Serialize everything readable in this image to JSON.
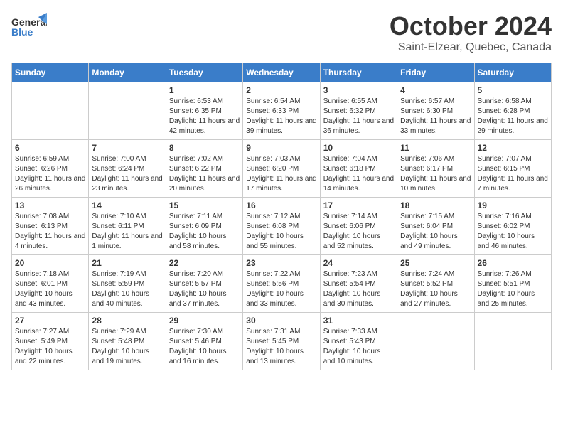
{
  "logo": {
    "general": "General",
    "blue": "Blue"
  },
  "title": "October 2024",
  "subtitle": "Saint-Elzear, Quebec, Canada",
  "weekdays": [
    "Sunday",
    "Monday",
    "Tuesday",
    "Wednesday",
    "Thursday",
    "Friday",
    "Saturday"
  ],
  "weeks": [
    [
      {
        "day": "",
        "sunrise": "",
        "sunset": "",
        "daylight": ""
      },
      {
        "day": "",
        "sunrise": "",
        "sunset": "",
        "daylight": ""
      },
      {
        "day": "1",
        "sunrise": "Sunrise: 6:53 AM",
        "sunset": "Sunset: 6:35 PM",
        "daylight": "Daylight: 11 hours and 42 minutes."
      },
      {
        "day": "2",
        "sunrise": "Sunrise: 6:54 AM",
        "sunset": "Sunset: 6:33 PM",
        "daylight": "Daylight: 11 hours and 39 minutes."
      },
      {
        "day": "3",
        "sunrise": "Sunrise: 6:55 AM",
        "sunset": "Sunset: 6:32 PM",
        "daylight": "Daylight: 11 hours and 36 minutes."
      },
      {
        "day": "4",
        "sunrise": "Sunrise: 6:57 AM",
        "sunset": "Sunset: 6:30 PM",
        "daylight": "Daylight: 11 hours and 33 minutes."
      },
      {
        "day": "5",
        "sunrise": "Sunrise: 6:58 AM",
        "sunset": "Sunset: 6:28 PM",
        "daylight": "Daylight: 11 hours and 29 minutes."
      }
    ],
    [
      {
        "day": "6",
        "sunrise": "Sunrise: 6:59 AM",
        "sunset": "Sunset: 6:26 PM",
        "daylight": "Daylight: 11 hours and 26 minutes."
      },
      {
        "day": "7",
        "sunrise": "Sunrise: 7:00 AM",
        "sunset": "Sunset: 6:24 PM",
        "daylight": "Daylight: 11 hours and 23 minutes."
      },
      {
        "day": "8",
        "sunrise": "Sunrise: 7:02 AM",
        "sunset": "Sunset: 6:22 PM",
        "daylight": "Daylight: 11 hours and 20 minutes."
      },
      {
        "day": "9",
        "sunrise": "Sunrise: 7:03 AM",
        "sunset": "Sunset: 6:20 PM",
        "daylight": "Daylight: 11 hours and 17 minutes."
      },
      {
        "day": "10",
        "sunrise": "Sunrise: 7:04 AM",
        "sunset": "Sunset: 6:18 PM",
        "daylight": "Daylight: 11 hours and 14 minutes."
      },
      {
        "day": "11",
        "sunrise": "Sunrise: 7:06 AM",
        "sunset": "Sunset: 6:17 PM",
        "daylight": "Daylight: 11 hours and 10 minutes."
      },
      {
        "day": "12",
        "sunrise": "Sunrise: 7:07 AM",
        "sunset": "Sunset: 6:15 PM",
        "daylight": "Daylight: 11 hours and 7 minutes."
      }
    ],
    [
      {
        "day": "13",
        "sunrise": "Sunrise: 7:08 AM",
        "sunset": "Sunset: 6:13 PM",
        "daylight": "Daylight: 11 hours and 4 minutes."
      },
      {
        "day": "14",
        "sunrise": "Sunrise: 7:10 AM",
        "sunset": "Sunset: 6:11 PM",
        "daylight": "Daylight: 11 hours and 1 minute."
      },
      {
        "day": "15",
        "sunrise": "Sunrise: 7:11 AM",
        "sunset": "Sunset: 6:09 PM",
        "daylight": "Daylight: 10 hours and 58 minutes."
      },
      {
        "day": "16",
        "sunrise": "Sunrise: 7:12 AM",
        "sunset": "Sunset: 6:08 PM",
        "daylight": "Daylight: 10 hours and 55 minutes."
      },
      {
        "day": "17",
        "sunrise": "Sunrise: 7:14 AM",
        "sunset": "Sunset: 6:06 PM",
        "daylight": "Daylight: 10 hours and 52 minutes."
      },
      {
        "day": "18",
        "sunrise": "Sunrise: 7:15 AM",
        "sunset": "Sunset: 6:04 PM",
        "daylight": "Daylight: 10 hours and 49 minutes."
      },
      {
        "day": "19",
        "sunrise": "Sunrise: 7:16 AM",
        "sunset": "Sunset: 6:02 PM",
        "daylight": "Daylight: 10 hours and 46 minutes."
      }
    ],
    [
      {
        "day": "20",
        "sunrise": "Sunrise: 7:18 AM",
        "sunset": "Sunset: 6:01 PM",
        "daylight": "Daylight: 10 hours and 43 minutes."
      },
      {
        "day": "21",
        "sunrise": "Sunrise: 7:19 AM",
        "sunset": "Sunset: 5:59 PM",
        "daylight": "Daylight: 10 hours and 40 minutes."
      },
      {
        "day": "22",
        "sunrise": "Sunrise: 7:20 AM",
        "sunset": "Sunset: 5:57 PM",
        "daylight": "Daylight: 10 hours and 37 minutes."
      },
      {
        "day": "23",
        "sunrise": "Sunrise: 7:22 AM",
        "sunset": "Sunset: 5:56 PM",
        "daylight": "Daylight: 10 hours and 33 minutes."
      },
      {
        "day": "24",
        "sunrise": "Sunrise: 7:23 AM",
        "sunset": "Sunset: 5:54 PM",
        "daylight": "Daylight: 10 hours and 30 minutes."
      },
      {
        "day": "25",
        "sunrise": "Sunrise: 7:24 AM",
        "sunset": "Sunset: 5:52 PM",
        "daylight": "Daylight: 10 hours and 27 minutes."
      },
      {
        "day": "26",
        "sunrise": "Sunrise: 7:26 AM",
        "sunset": "Sunset: 5:51 PM",
        "daylight": "Daylight: 10 hours and 25 minutes."
      }
    ],
    [
      {
        "day": "27",
        "sunrise": "Sunrise: 7:27 AM",
        "sunset": "Sunset: 5:49 PM",
        "daylight": "Daylight: 10 hours and 22 minutes."
      },
      {
        "day": "28",
        "sunrise": "Sunrise: 7:29 AM",
        "sunset": "Sunset: 5:48 PM",
        "daylight": "Daylight: 10 hours and 19 minutes."
      },
      {
        "day": "29",
        "sunrise": "Sunrise: 7:30 AM",
        "sunset": "Sunset: 5:46 PM",
        "daylight": "Daylight: 10 hours and 16 minutes."
      },
      {
        "day": "30",
        "sunrise": "Sunrise: 7:31 AM",
        "sunset": "Sunset: 5:45 PM",
        "daylight": "Daylight: 10 hours and 13 minutes."
      },
      {
        "day": "31",
        "sunrise": "Sunrise: 7:33 AM",
        "sunset": "Sunset: 5:43 PM",
        "daylight": "Daylight: 10 hours and 10 minutes."
      },
      {
        "day": "",
        "sunrise": "",
        "sunset": "",
        "daylight": ""
      },
      {
        "day": "",
        "sunrise": "",
        "sunset": "",
        "daylight": ""
      }
    ]
  ]
}
